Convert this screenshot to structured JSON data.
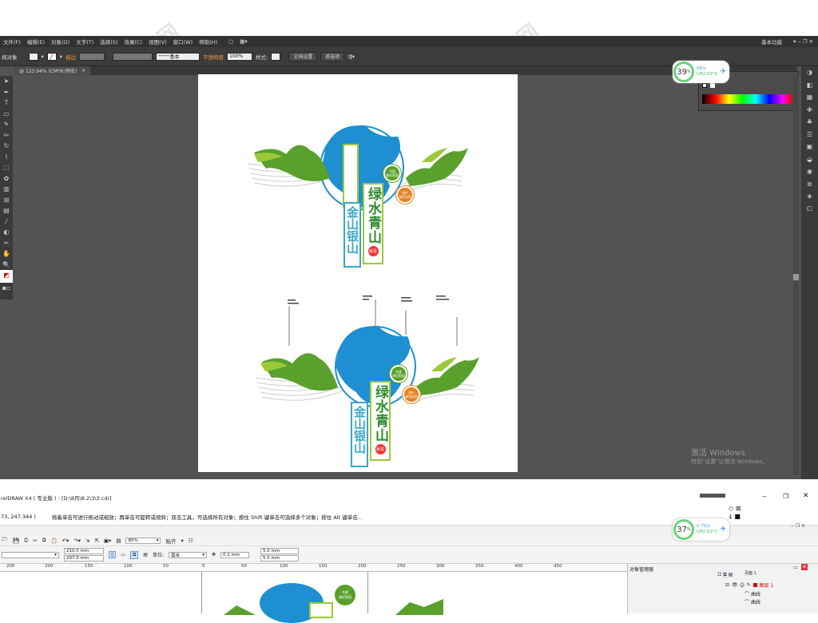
{
  "illustrator": {
    "menu": [
      "文件(F)",
      "编辑(E)",
      "对象(O)",
      "文字(T)",
      "选择(S)",
      "效果(C)",
      "视图(V)",
      "窗口(W)",
      "帮助(H)"
    ],
    "workspace": "基本功能",
    "control": {
      "no_selection": "择对象",
      "stroke_label": "描边",
      "stroke_style": "基本",
      "opacity_label": "不透明度",
      "opacity_value": "100%",
      "style_label": "样式:",
      "doc_setup": "文档设置",
      "prefs": "首选项"
    },
    "doc_tab": "@ 123.94% (CMYK/预览)",
    "doc_close": "×"
  },
  "design": {
    "title": "绿水青山",
    "subtitle": "金山银山",
    "badge": "就是",
    "circle_top": [
      "共建",
      "美好家园"
    ],
    "circle_right": [
      "保护",
      "绿色自然"
    ]
  },
  "cpu_top": {
    "percent": "39",
    "unit": "%",
    "rate": "0K/s",
    "temp": "CPU 52°C"
  },
  "cpu_bottom": {
    "percent": "37",
    "unit": "%",
    "rate": "0.7K/s",
    "temp": "CPU 52°C"
  },
  "windows": {
    "line1": "激活 Windows",
    "line2": "转到\"设置\"以激活 Windows。"
  },
  "coreldraw": {
    "title": "relDRAW X4 ( 专业版 ) - [D:\\8月\\8.2\\3\\3.cdr]",
    "coords": "73, 247.344 )",
    "status": "拖着单击可进行拖动或缩放；再单击可旋转或倾斜；双击工具，可选择所有对象；按住 Shift 键单击可选择多个对象；按住 Alt 键单击...",
    "zoom": "80%",
    "snap": "贴齐",
    "width": "210.0 mm",
    "height": "297.0 mm",
    "unit_label": "单位:",
    "unit": "毫米",
    "nudge": "0.1 mm",
    "dup_x": "5.0 mm",
    "dup_y": "5.0 mm",
    "ruler_ticks": [
      "200",
      "150",
      "100",
      "50",
      "0",
      "50",
      "100",
      "150",
      "200",
      "250",
      "300",
      "350",
      "400",
      "450"
    ],
    "object_manager": "对象管理器",
    "layer": "图层 1",
    "items": [
      "曲线",
      "曲线"
    ],
    "page_label": "页面 1"
  },
  "colors": {
    "green": "#5aa02c",
    "blue": "#1e8fd0",
    "orange": "#e8821e",
    "teal": "#3aa6c8"
  }
}
